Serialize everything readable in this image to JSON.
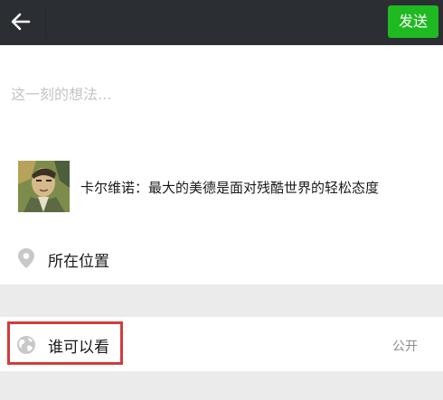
{
  "topbar": {
    "back_icon": "arrow-left-icon",
    "send_label": "发送",
    "send_color": "#1fb922",
    "background": "#2b2e33"
  },
  "compose": {
    "placeholder": "这一刻的想法...",
    "value": ""
  },
  "share_card": {
    "title": "卡尔维诺：最大的美德是面对残酷世界的轻松态度"
  },
  "location": {
    "icon": "map-pin-icon",
    "label": "所在位置"
  },
  "visibility": {
    "icon": "globe-icon",
    "label": "谁可以看",
    "value": "公开",
    "highlight_color": "#d23b3b"
  }
}
